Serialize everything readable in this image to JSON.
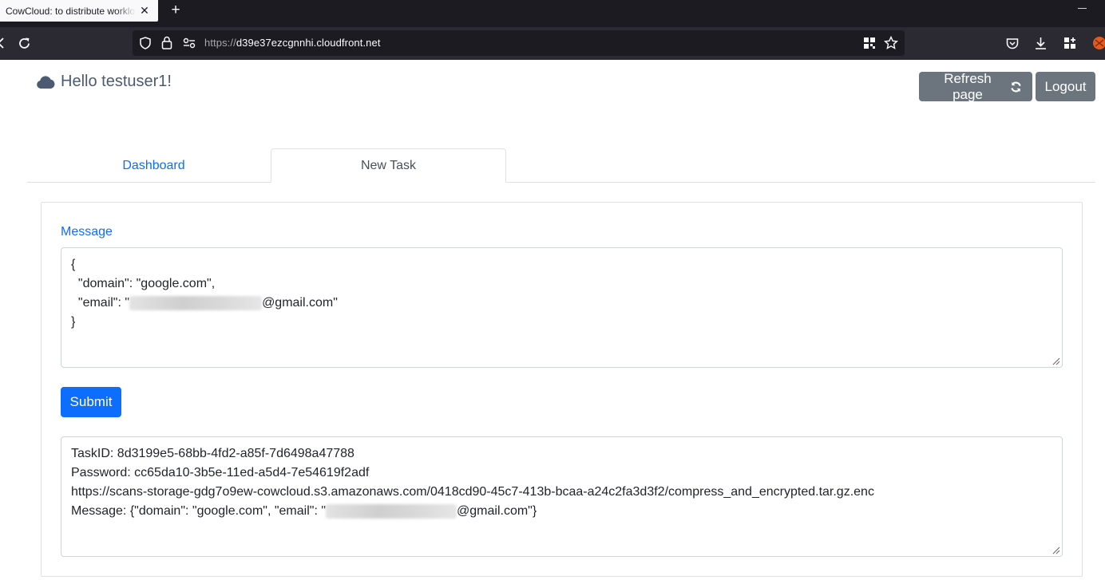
{
  "browser": {
    "tab_title": "CowCloud: to distribute worklo",
    "tab_close": "✕",
    "new_tab": "+",
    "url_protocol": "https://",
    "url_host": "d39e37ezcgnnhi.cloudfront.net"
  },
  "header": {
    "greeting": "Hello testuser1!",
    "refresh_label": "Refresh page",
    "logout_label": "Logout"
  },
  "tabs": [
    {
      "label": "Dashboard",
      "active": false
    },
    {
      "label": "New Task",
      "active": true
    }
  ],
  "form": {
    "message_label": "Message",
    "message_lines": {
      "open": "{",
      "domain": "  \"domain\": \"google.com\",",
      "email_prefix": "  \"email\": \"",
      "email_suffix": "@gmail.com\"",
      "close": "}"
    },
    "submit_label": "Submit"
  },
  "output": {
    "task_id": "TaskID: 8d3199e5-68bb-4fd2-a85f-7d6498a47788",
    "password": "Password: cc65da10-3b5e-11ed-a5d4-7e54619f2adf",
    "url": "https://scans-storage-gdg7o9ew-cowcloud.s3.amazonaws.com/0418cd90-45c7-413b-bcaa-a24c2fa3d3f2/compress_and_encrypted.tar.gz.enc",
    "message_prefix": "Message: {\"domain\": \"google.com\", \"email\": \"",
    "message_suffix": "@gmail.com\"}"
  },
  "colors": {
    "primary": "#0d6efd",
    "secondary": "#6c757d",
    "greeting": "#4c5a73"
  }
}
